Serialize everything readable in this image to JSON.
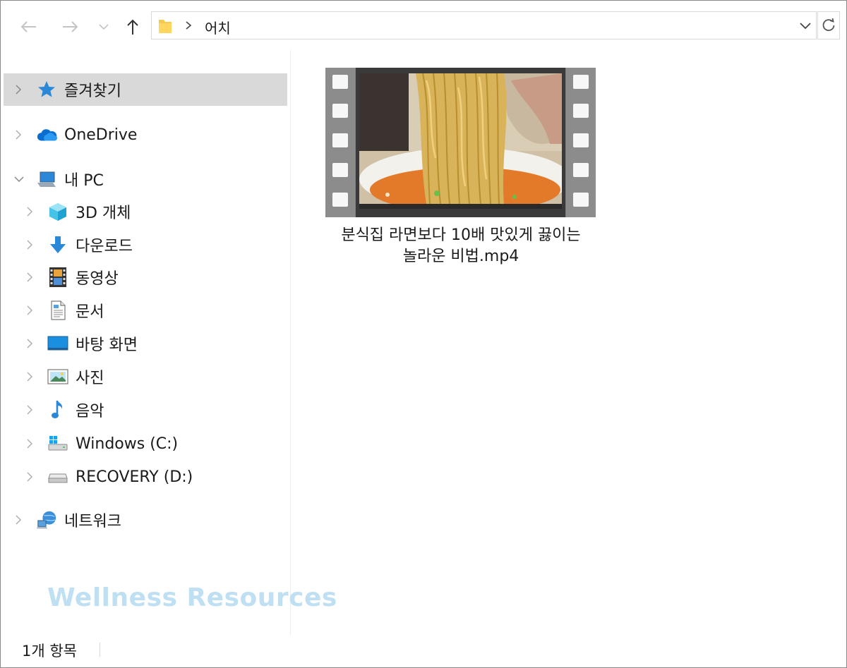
{
  "address_bar": {
    "breadcrumb": [
      "어치"
    ]
  },
  "nav_pane": {
    "items": [
      {
        "label": "즐겨찾기",
        "icon": "star-icon",
        "selected": true
      },
      {
        "label": "OneDrive",
        "icon": "cloud-icon"
      },
      {
        "label": "내 PC",
        "icon": "computer-icon",
        "expanded": true
      },
      {
        "label": "3D 개체",
        "icon": "cube-icon"
      },
      {
        "label": "다운로드",
        "icon": "download-arrow-icon"
      },
      {
        "label": "동영상",
        "icon": "film-icon"
      },
      {
        "label": "문서",
        "icon": "document-icon"
      },
      {
        "label": "바탕 화면",
        "icon": "desktop-icon"
      },
      {
        "label": "사진",
        "icon": "picture-icon"
      },
      {
        "label": "음악",
        "icon": "music-note-icon"
      },
      {
        "label": "Windows (C:)",
        "icon": "windows-drive-icon"
      },
      {
        "label": "RECOVERY (D:)",
        "icon": "drive-icon"
      },
      {
        "label": "네트워크",
        "icon": "network-icon"
      }
    ]
  },
  "watermark": "Wellness Resources",
  "content": {
    "files": [
      {
        "name_line1": "분식집 라면보다 10배 맛있게 끓이는",
        "name_line2": "놀라운 비법.mp4",
        "icon": "video-thumbnail"
      }
    ]
  },
  "status_bar": {
    "item_count": "1개 항목"
  },
  "colors": {
    "accent_blue": "#2b88d8",
    "selection_bg": "#d9d9d9",
    "watermark": "#bfe0f2"
  }
}
